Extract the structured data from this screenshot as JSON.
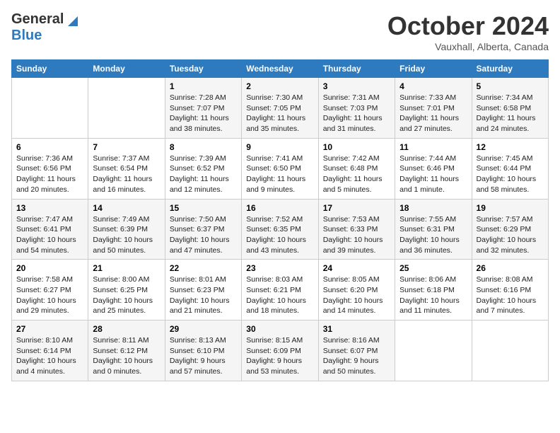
{
  "header": {
    "logo_general": "General",
    "logo_blue": "Blue",
    "month": "October 2024",
    "location": "Vauxhall, Alberta, Canada"
  },
  "days_of_week": [
    "Sunday",
    "Monday",
    "Tuesday",
    "Wednesday",
    "Thursday",
    "Friday",
    "Saturday"
  ],
  "weeks": [
    [
      {
        "day": "",
        "content": ""
      },
      {
        "day": "",
        "content": ""
      },
      {
        "day": "1",
        "content": "Sunrise: 7:28 AM\nSunset: 7:07 PM\nDaylight: 11 hours and 38 minutes."
      },
      {
        "day": "2",
        "content": "Sunrise: 7:30 AM\nSunset: 7:05 PM\nDaylight: 11 hours and 35 minutes."
      },
      {
        "day": "3",
        "content": "Sunrise: 7:31 AM\nSunset: 7:03 PM\nDaylight: 11 hours and 31 minutes."
      },
      {
        "day": "4",
        "content": "Sunrise: 7:33 AM\nSunset: 7:01 PM\nDaylight: 11 hours and 27 minutes."
      },
      {
        "day": "5",
        "content": "Sunrise: 7:34 AM\nSunset: 6:58 PM\nDaylight: 11 hours and 24 minutes."
      }
    ],
    [
      {
        "day": "6",
        "content": "Sunrise: 7:36 AM\nSunset: 6:56 PM\nDaylight: 11 hours and 20 minutes."
      },
      {
        "day": "7",
        "content": "Sunrise: 7:37 AM\nSunset: 6:54 PM\nDaylight: 11 hours and 16 minutes."
      },
      {
        "day": "8",
        "content": "Sunrise: 7:39 AM\nSunset: 6:52 PM\nDaylight: 11 hours and 12 minutes."
      },
      {
        "day": "9",
        "content": "Sunrise: 7:41 AM\nSunset: 6:50 PM\nDaylight: 11 hours and 9 minutes."
      },
      {
        "day": "10",
        "content": "Sunrise: 7:42 AM\nSunset: 6:48 PM\nDaylight: 11 hours and 5 minutes."
      },
      {
        "day": "11",
        "content": "Sunrise: 7:44 AM\nSunset: 6:46 PM\nDaylight: 11 hours and 1 minute."
      },
      {
        "day": "12",
        "content": "Sunrise: 7:45 AM\nSunset: 6:44 PM\nDaylight: 10 hours and 58 minutes."
      }
    ],
    [
      {
        "day": "13",
        "content": "Sunrise: 7:47 AM\nSunset: 6:41 PM\nDaylight: 10 hours and 54 minutes."
      },
      {
        "day": "14",
        "content": "Sunrise: 7:49 AM\nSunset: 6:39 PM\nDaylight: 10 hours and 50 minutes."
      },
      {
        "day": "15",
        "content": "Sunrise: 7:50 AM\nSunset: 6:37 PM\nDaylight: 10 hours and 47 minutes."
      },
      {
        "day": "16",
        "content": "Sunrise: 7:52 AM\nSunset: 6:35 PM\nDaylight: 10 hours and 43 minutes."
      },
      {
        "day": "17",
        "content": "Sunrise: 7:53 AM\nSunset: 6:33 PM\nDaylight: 10 hours and 39 minutes."
      },
      {
        "day": "18",
        "content": "Sunrise: 7:55 AM\nSunset: 6:31 PM\nDaylight: 10 hours and 36 minutes."
      },
      {
        "day": "19",
        "content": "Sunrise: 7:57 AM\nSunset: 6:29 PM\nDaylight: 10 hours and 32 minutes."
      }
    ],
    [
      {
        "day": "20",
        "content": "Sunrise: 7:58 AM\nSunset: 6:27 PM\nDaylight: 10 hours and 29 minutes."
      },
      {
        "day": "21",
        "content": "Sunrise: 8:00 AM\nSunset: 6:25 PM\nDaylight: 10 hours and 25 minutes."
      },
      {
        "day": "22",
        "content": "Sunrise: 8:01 AM\nSunset: 6:23 PM\nDaylight: 10 hours and 21 minutes."
      },
      {
        "day": "23",
        "content": "Sunrise: 8:03 AM\nSunset: 6:21 PM\nDaylight: 10 hours and 18 minutes."
      },
      {
        "day": "24",
        "content": "Sunrise: 8:05 AM\nSunset: 6:20 PM\nDaylight: 10 hours and 14 minutes."
      },
      {
        "day": "25",
        "content": "Sunrise: 8:06 AM\nSunset: 6:18 PM\nDaylight: 10 hours and 11 minutes."
      },
      {
        "day": "26",
        "content": "Sunrise: 8:08 AM\nSunset: 6:16 PM\nDaylight: 10 hours and 7 minutes."
      }
    ],
    [
      {
        "day": "27",
        "content": "Sunrise: 8:10 AM\nSunset: 6:14 PM\nDaylight: 10 hours and 4 minutes."
      },
      {
        "day": "28",
        "content": "Sunrise: 8:11 AM\nSunset: 6:12 PM\nDaylight: 10 hours and 0 minutes."
      },
      {
        "day": "29",
        "content": "Sunrise: 8:13 AM\nSunset: 6:10 PM\nDaylight: 9 hours and 57 minutes."
      },
      {
        "day": "30",
        "content": "Sunrise: 8:15 AM\nSunset: 6:09 PM\nDaylight: 9 hours and 53 minutes."
      },
      {
        "day": "31",
        "content": "Sunrise: 8:16 AM\nSunset: 6:07 PM\nDaylight: 9 hours and 50 minutes."
      },
      {
        "day": "",
        "content": ""
      },
      {
        "day": "",
        "content": ""
      }
    ]
  ]
}
